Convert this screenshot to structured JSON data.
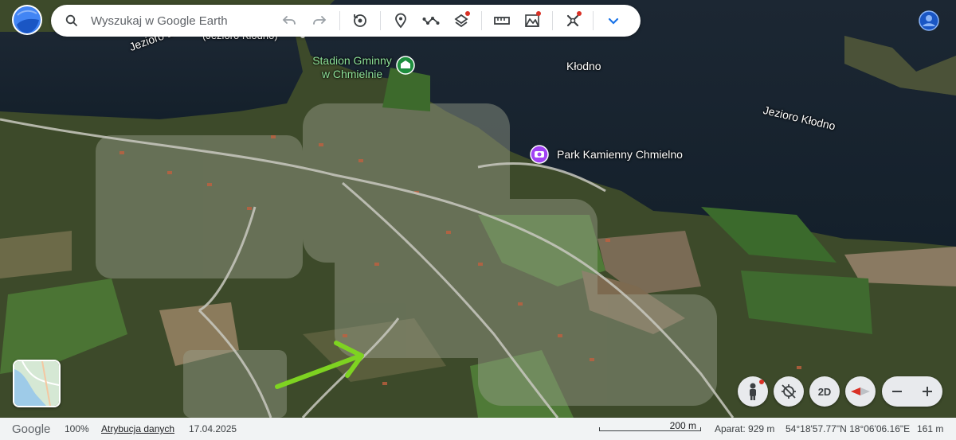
{
  "search": {
    "placeholder": "Wyszukaj w Google Earth"
  },
  "toolbar": {
    "icons": [
      "undo-icon",
      "redo-icon",
      "history-icon",
      "pin-icon",
      "path-icon",
      "layers-icon",
      "ruler-icon",
      "map-style-icon",
      "project-icon",
      "chevron-down-icon"
    ]
  },
  "map_labels": {
    "stadium": "Stadion Gminny",
    "stadium_line2": "w Chmielnie",
    "town": "Kłodno",
    "lake": "Jezioro Kłodno",
    "lake_partial_left": "Jezioro B",
    "lake_partial_top": "(Jezioro Kłodno)",
    "park": "Park Kamienny Chmielno"
  },
  "controls": {
    "view_mode": "2D"
  },
  "status": {
    "logo": "Google",
    "zoom": "100%",
    "attribution": "Atrybucja danych",
    "date": "17.04.2025",
    "scale": "200 m",
    "camera": "Aparat: 929 m",
    "coords": "54°18'57.77\"N 18°06'06.16\"E",
    "elevation": "161 m"
  },
  "colors": {
    "accent": "#1a73e8",
    "notify": "#d93025",
    "poi_green": "#1e8e3e",
    "poi_purple": "#a142f4"
  }
}
